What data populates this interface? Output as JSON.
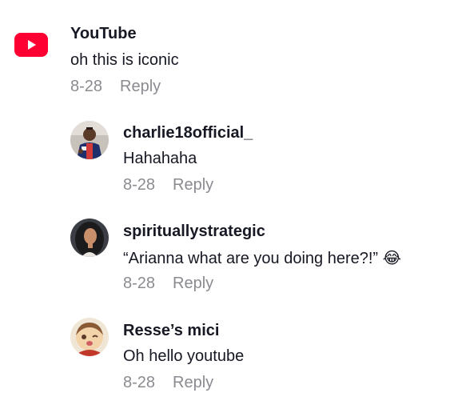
{
  "comments": [
    {
      "username": "YouTube",
      "text": "oh this is iconic",
      "date": "8-28",
      "reply_label": "Reply",
      "avatar_icon": "youtube-logo-icon"
    },
    {
      "username": "charlie18official_",
      "text": "Hahahaha",
      "date": "8-28",
      "reply_label": "Reply",
      "avatar_icon": "user-avatar-photo"
    },
    {
      "username": "spirituallystrategic",
      "text": "“Arianna what are you doing here?!” 😂",
      "date": "8-28",
      "reply_label": "Reply",
      "avatar_icon": "user-avatar-photo"
    },
    {
      "username": "Resse’s mici",
      "text": "Oh hello youtube",
      "date": "8-28",
      "reply_label": "Reply",
      "avatar_icon": "user-avatar-photo"
    }
  ],
  "colors": {
    "youtube_red": "#ff0033",
    "meta_gray": "#8a8b91",
    "text_dark": "#161823"
  }
}
